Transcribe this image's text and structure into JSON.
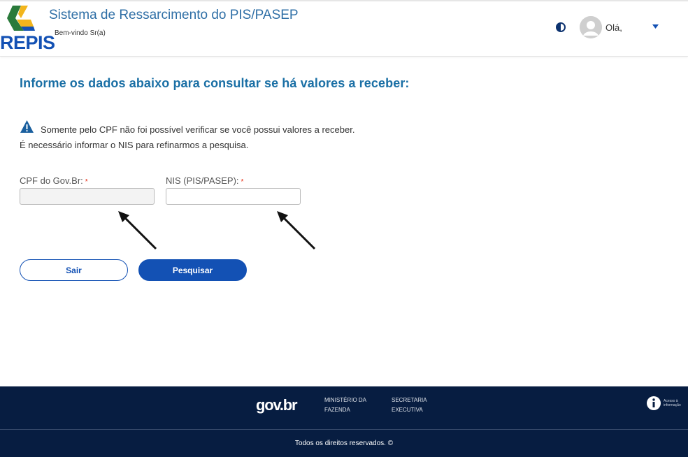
{
  "header": {
    "logo_text": "REPIS",
    "app_title": "Sistema de Ressarcimento do PIS/PASEP",
    "welcome": "Bem-vindo Sr(a)",
    "contrast_icon": "contrast-icon",
    "user_greeting": "Olá,",
    "menu_icon": "caret-down-icon"
  },
  "main": {
    "title": "Informe os dados abaixo para consultar se há valores a receber:",
    "alert": {
      "icon": "warning-icon",
      "line1": "Somente pelo CPF não foi possível verificar se você possui valores a receber.",
      "line2": "É necessário informar o NIS para refinarmos a pesquisa."
    },
    "fields": {
      "cpf_label": "CPF do Gov.Br:",
      "nis_label": "NIS (PIS/PASEP):",
      "required_mark": "*",
      "cpf_value": "",
      "nis_value": ""
    },
    "buttons": {
      "exit_label": "Sair",
      "search_label": "Pesquisar"
    }
  },
  "footer": {
    "gov_logo": "gov.br",
    "ministerio": "MINISTÉRIO DA FAZENDA",
    "secretaria": "SECRETARIA EXECUTIVA",
    "info_label": "Acesso à informação",
    "rights": "Todos os direitos reservados. ©"
  },
  "colors": {
    "primary": "#1351b4",
    "title": "#1a6fa5",
    "footer_bg": "#071d41",
    "required": "#e52207",
    "warning_icon": "#1a5f9e"
  }
}
